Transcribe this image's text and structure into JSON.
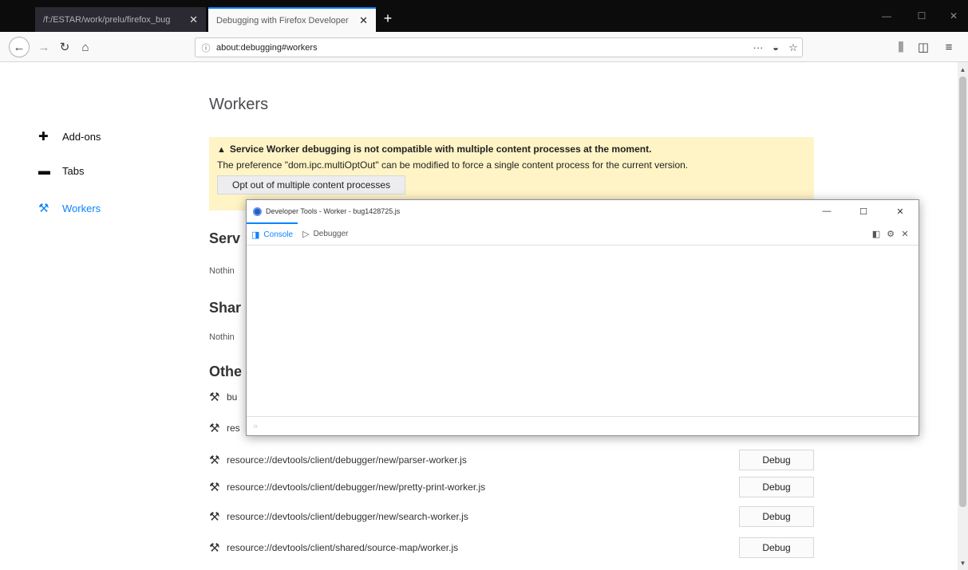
{
  "browser": {
    "tabs": [
      {
        "label": "/f:/ESTAR/work/prelu/firefox_bug",
        "active": false
      },
      {
        "label": "Debugging with Firefox Developer",
        "active": true
      }
    ],
    "tab_close_glyph": "✕",
    "new_tab_glyph": "+",
    "window_controls": {
      "minimize": "—",
      "maximize": "☐",
      "close": "✕"
    },
    "nav": {
      "back": "←",
      "forward": "→",
      "reload": "↻",
      "home": "⌂"
    },
    "url": "about:debugging#workers",
    "page_actions": {
      "more": "···",
      "pocket": "◒",
      "bookmark": "☆"
    },
    "right_tools": {
      "library": "⫼",
      "sidebar": "◫",
      "menu": "≡"
    }
  },
  "sidebar": {
    "items": [
      {
        "label": "Add-ons",
        "icon": "puzzle-icon",
        "glyph": "✚",
        "selected": false
      },
      {
        "label": "Tabs",
        "icon": "tabs-icon",
        "glyph": "▬",
        "selected": false
      },
      {
        "label": "Workers",
        "icon": "workers-icon",
        "glyph": "⚒",
        "selected": true
      }
    ]
  },
  "main": {
    "heading": "Workers",
    "warning": {
      "title": "Service Worker debugging is not compatible with multiple content processes at the moment.",
      "body": "The preference \"dom.ipc.multiOptOut\" can be modified to force a single content process for the current version.",
      "button": "Opt out of multiple content processes",
      "icon_glyph": "▲"
    },
    "sections": {
      "service": {
        "title": "Serv",
        "nothing": "Nothin"
      },
      "shared": {
        "title": "Shar",
        "nothing": "Nothin"
      },
      "other": {
        "title": "Othe"
      }
    },
    "workers": [
      {
        "url": "bu",
        "debug": ""
      },
      {
        "url": "res",
        "debug": ""
      },
      {
        "url": "resource://devtools/client/debugger/new/parser-worker.js",
        "debug": "Debug"
      },
      {
        "url": "resource://devtools/client/debugger/new/pretty-print-worker.js",
        "debug": "Debug"
      },
      {
        "url": "resource://devtools/client/debugger/new/search-worker.js",
        "debug": "Debug"
      },
      {
        "url": "resource://devtools/client/shared/source-map/worker.js",
        "debug": "Debug"
      }
    ],
    "worker_icon_glyph": "⚒"
  },
  "devtools": {
    "title": "Developer Tools - Worker - bug1428725.js",
    "window_controls": {
      "minimize": "—",
      "maximize": "☐",
      "close": "✕"
    },
    "tabs": [
      {
        "label": "Console",
        "glyph": "◨",
        "selected": true
      },
      {
        "label": "Debugger",
        "glyph": "▷",
        "selected": false
      }
    ],
    "tools": {
      "dock": "◧",
      "settings": "⚙",
      "close": "✕"
    },
    "input_prompt": "»"
  },
  "colors": {
    "accent": "#0a84ff",
    "warning_bg": "#fff4c6",
    "tabbar": "#0c0c0d"
  }
}
